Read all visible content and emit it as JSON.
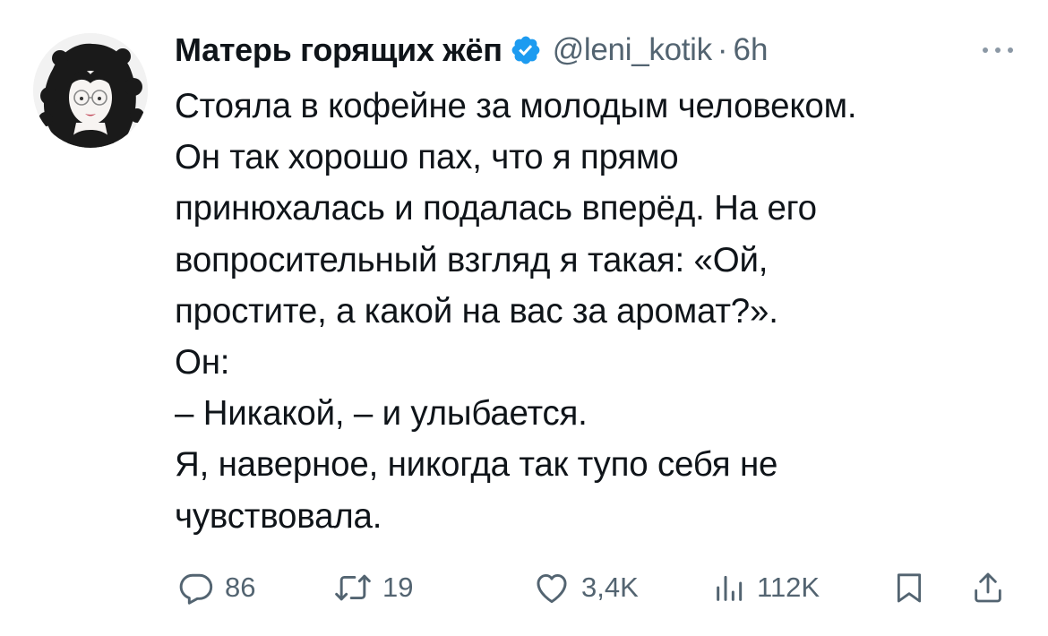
{
  "author": {
    "display_name": "Матерь горящих жёп",
    "handle": "@leni_kotik",
    "separator": "·",
    "time": "6h",
    "verified": true,
    "verified_color": "#1d9bf0"
  },
  "tweet": {
    "lines": [
      "Стояла в кофейне за молодым человеком.",
      "Он так хорошо пах, что я прямо",
      "принюхалась и подалась вперёд. На его",
      "вопросительный взгляд я такая: «Ой,",
      "простите, а какой на вас за аромат?».",
      "Он:",
      "– Никакой, – и улыбается.",
      "Я, наверное, никогда так тупо себя не",
      "чувствовала."
    ]
  },
  "actions": {
    "replies": "86",
    "reposts": "19",
    "likes": "3,4K",
    "views": "112K"
  },
  "icons": {
    "more": "more-icon",
    "reply": "reply-icon",
    "repost": "repost-icon",
    "like": "heart-icon",
    "views": "views-icon",
    "bookmark": "bookmark-icon",
    "share": "share-icon"
  },
  "colors": {
    "text": "#0f1419",
    "secondary": "#536471",
    "verified": "#1d9bf0"
  }
}
